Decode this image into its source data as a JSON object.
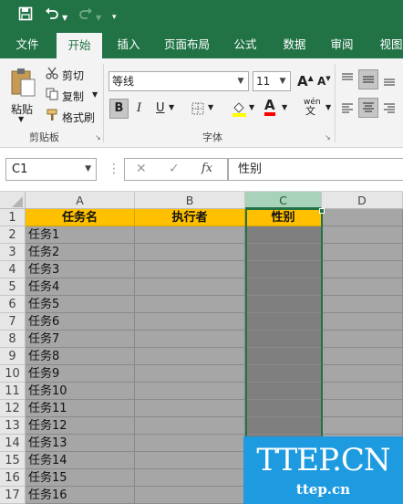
{
  "quick_access": {
    "save_icon": "save-icon",
    "undo_icon": "undo-icon",
    "redo_icon": "redo-icon",
    "customize_icon": "customize-icon"
  },
  "tabs": [
    {
      "label": "文件"
    },
    {
      "label": "开始",
      "active": true
    },
    {
      "label": "插入"
    },
    {
      "label": "页面布局"
    },
    {
      "label": "公式"
    },
    {
      "label": "数据"
    },
    {
      "label": "审阅"
    },
    {
      "label": "视图"
    }
  ],
  "ribbon": {
    "clipboard": {
      "paste_label": "粘贴",
      "cut_label": "剪切",
      "copy_label": "复制",
      "format_painter_label": "格式刷",
      "group_label": "剪贴板"
    },
    "font": {
      "font_name": "等线",
      "font_size": "11",
      "group_label": "字体",
      "bold": "B",
      "italic": "I",
      "underline": "U",
      "phonetic_top": "wén",
      "phonetic_bottom": "文",
      "grow": "A",
      "shrink": "A",
      "font_color_letter": "A"
    }
  },
  "formula_bar": {
    "name_box": "C1",
    "fx_label": "fx",
    "cancel_icon": "✕",
    "enter_icon": "✓",
    "content": "性别"
  },
  "colors": {
    "accent": "#217346",
    "header_fill": "#ffc000",
    "data_fill": "#a6a6a6",
    "selected_fill": "#7f7f7f",
    "watermark": "#1e9be0"
  },
  "sheet": {
    "columns": [
      "A",
      "B",
      "C",
      "D"
    ],
    "selected_column": "C",
    "row_numbers": [
      "1",
      "2",
      "3",
      "4",
      "5",
      "6",
      "7",
      "8",
      "9",
      "10",
      "11",
      "12",
      "13",
      "14",
      "15",
      "16",
      "17"
    ],
    "headers": [
      "任务名",
      "执行者",
      "性别"
    ],
    "tasks": [
      "任务1",
      "任务2",
      "任务3",
      "任务4",
      "任务5",
      "任务6",
      "任务7",
      "任务8",
      "任务9",
      "任务10",
      "任务11",
      "任务12",
      "任务13",
      "任务14",
      "任务15",
      "任务16"
    ]
  },
  "watermark": {
    "brand": "TTEP.CN",
    "url": "ttep.cn"
  }
}
